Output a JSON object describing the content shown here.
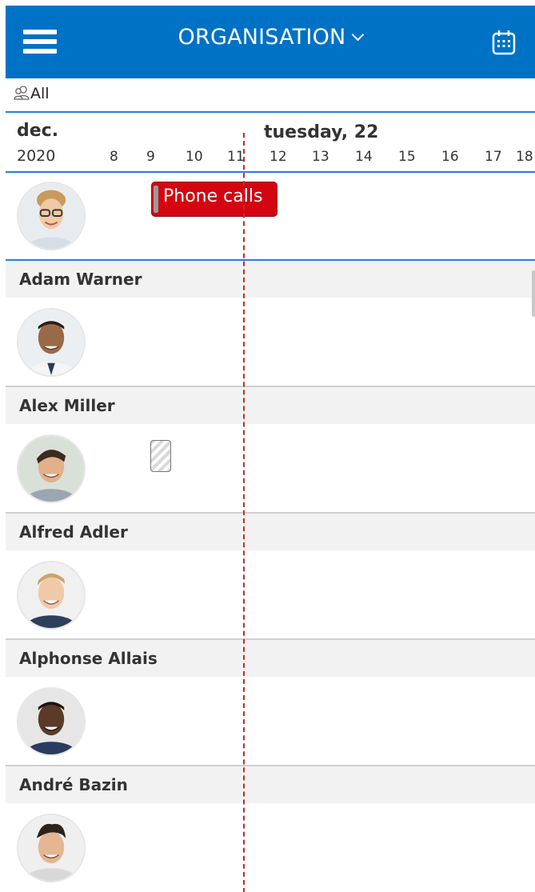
{
  "header": {
    "title": "ORGANISATION",
    "bg_color": "#0072c6",
    "menu_icon": "hamburger-menu-icon",
    "dropdown_icon": "chevron-down-icon",
    "calendar_icon": "calendar-icon"
  },
  "filter": {
    "icon": "group-users-icon",
    "label": "All"
  },
  "date_header": {
    "month": "dec.",
    "year": "2020",
    "day": "tuesday, 22",
    "hours": [
      "8",
      "9",
      "10",
      "11",
      "12",
      "13",
      "14",
      "15",
      "16",
      "17",
      "18"
    ]
  },
  "self_row": {
    "avatar": "woman-with-glasses-avatar",
    "event": {
      "label": "Phone calls",
      "color": "#d40511"
    }
  },
  "people": [
    {
      "name": "Adam Warner",
      "avatar": "man-smiling-avatar"
    },
    {
      "name": "Alex Miller",
      "avatar": "man-dark-hair-avatar",
      "event": "hatched-block"
    },
    {
      "name": "Alfred Adler",
      "avatar": "blond-man-avatar"
    },
    {
      "name": "Alphonse Allais",
      "avatar": "man-dark-skin-avatar"
    },
    {
      "name": "André Bazin",
      "avatar": "man-curly-hair-avatar"
    }
  ],
  "colors": {
    "accent": "#0072c6",
    "event_red": "#d40511",
    "now_line": "#b83030",
    "name_bar": "#f2f2f2"
  }
}
